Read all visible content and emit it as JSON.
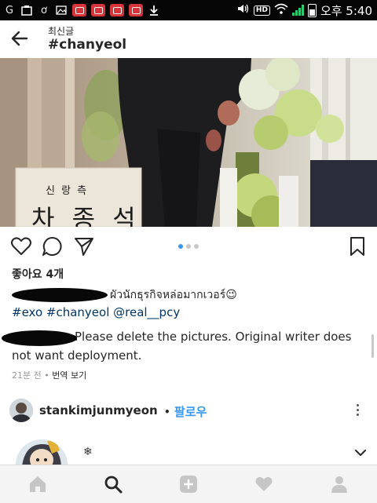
{
  "status_bar": {
    "time": "오후 5:40",
    "hd_badge": "HD",
    "icons": [
      "g-icon",
      "image-icon",
      "g2-icon",
      "gallery-icon",
      "notification-icon",
      "notification-icon",
      "notification-icon",
      "notification-icon",
      "download-icon",
      "volume-icon",
      "wifi-icon",
      "signal-icon",
      "battery-icon"
    ]
  },
  "header": {
    "subtitle": "최신글",
    "title": "#chanyeol",
    "back_icon": "arrow-left-icon"
  },
  "photo": {
    "sign_top": "신 랑 측",
    "sign_main": "차 종 석"
  },
  "post": {
    "likes": "좋아요 4개",
    "caption_text": "ผัวนักธุรกิจหล่อมากเวอร์",
    "caption_emoji": "😉",
    "tags": "#exo #chanyeol @real__pcy",
    "comment_text": "Please delete the pictures. Original writer does not want deployment.",
    "time_ago": "21분 전",
    "meta_sep": " • ",
    "translate": "번역 보기",
    "carousel_count": 3,
    "carousel_active": 0
  },
  "next_post": {
    "username": "stankimjunmyeon",
    "sep": "•",
    "follow": "팔로우"
  },
  "strip": {
    "snow": "❄"
  },
  "nav": {
    "items": [
      "home-icon",
      "search-icon",
      "add-post-icon",
      "heart-icon",
      "profile-icon"
    ],
    "active": "search-icon"
  },
  "colors": {
    "link": "#003569",
    "follow": "#3897f0",
    "status_bg": "#050505"
  }
}
